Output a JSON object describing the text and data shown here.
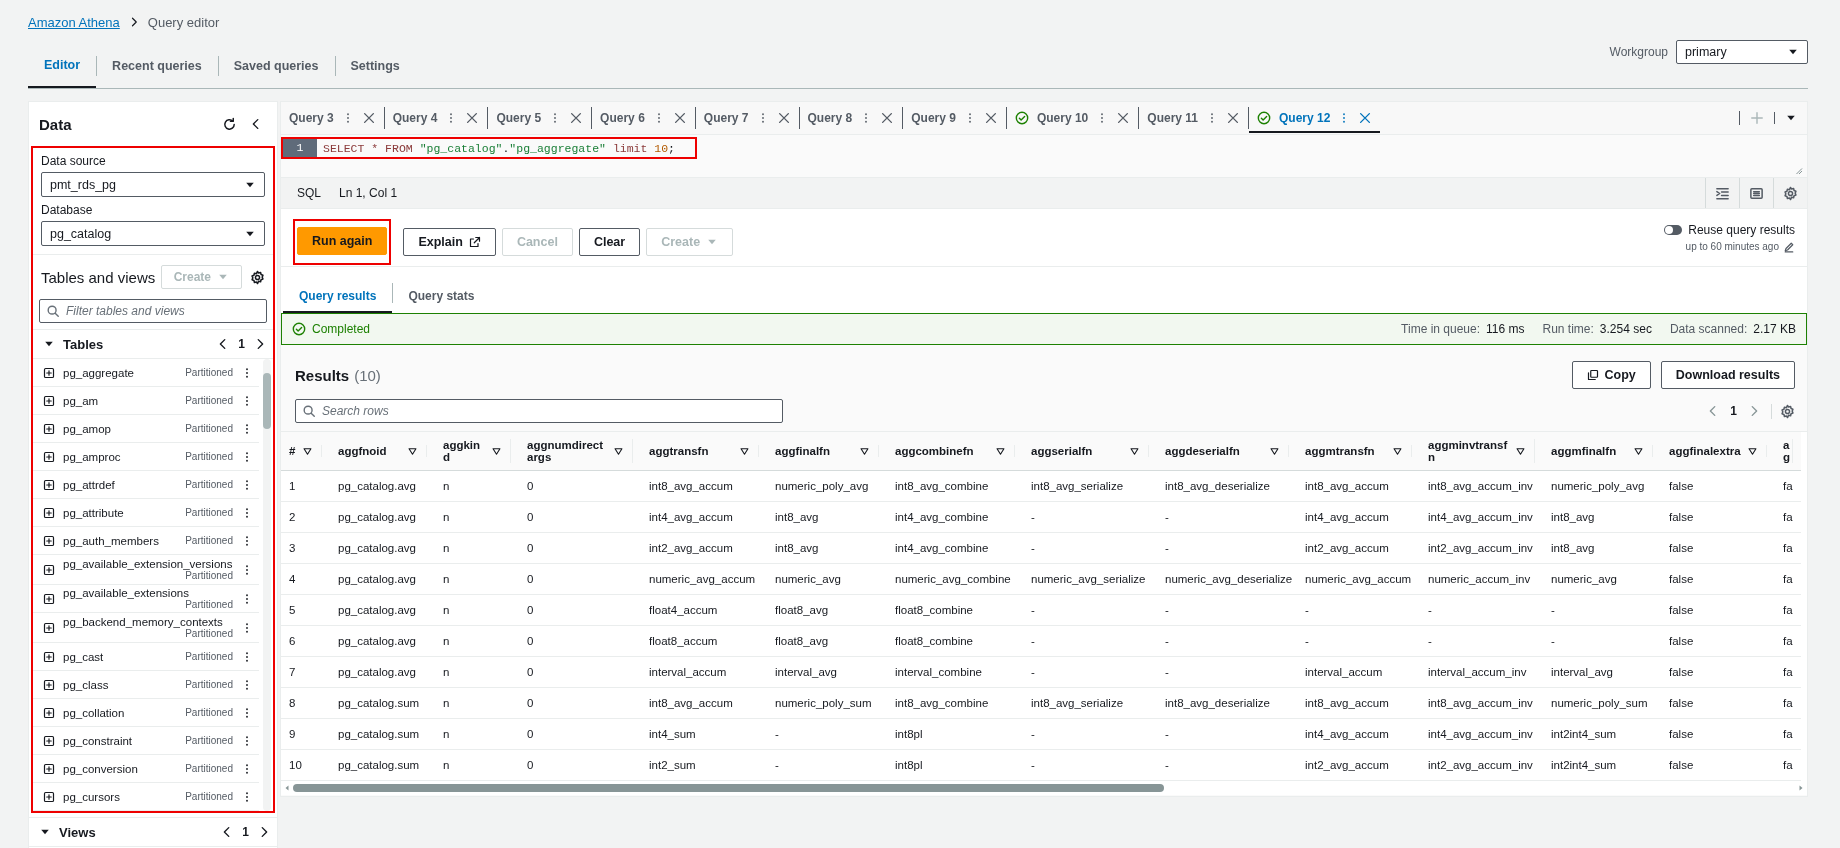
{
  "breadcrumb": [
    {
      "label": "Amazon Athena",
      "kind": "link"
    },
    {
      "label": "Query editor",
      "kind": "current"
    }
  ],
  "top_tabs": [
    {
      "label": "Editor",
      "selected": true
    },
    {
      "label": "Recent queries",
      "selected": false
    },
    {
      "label": "Saved queries",
      "selected": false
    },
    {
      "label": "Settings",
      "selected": false
    }
  ],
  "workgroup": {
    "label": "Workgroup",
    "value": "primary"
  },
  "sidebar": {
    "title": "Data",
    "data_source": {
      "label": "Data source",
      "value": "pmt_rds_pg"
    },
    "database": {
      "label": "Database",
      "value": "pg_catalog"
    },
    "tables_and_views": {
      "title": "Tables and views",
      "create": "Create"
    },
    "filter": {
      "placeholder": "Filter tables and views"
    },
    "tables": {
      "title": "Tables",
      "page": "1",
      "items": [
        {
          "name": "pg_aggregate",
          "badge": "Partitioned"
        },
        {
          "name": "pg_am",
          "badge": "Partitioned"
        },
        {
          "name": "pg_amop",
          "badge": "Partitioned"
        },
        {
          "name": "pg_amproc",
          "badge": "Partitioned"
        },
        {
          "name": "pg_attrdef",
          "badge": "Partitioned"
        },
        {
          "name": "pg_attribute",
          "badge": "Partitioned"
        },
        {
          "name": "pg_auth_members",
          "badge": "Partitioned"
        },
        {
          "name": "pg_available_extension_versions",
          "badge": "Partitioned"
        },
        {
          "name": "pg_available_extensions",
          "badge": "Partitioned"
        },
        {
          "name": "pg_backend_memory_contexts",
          "badge": "Partitioned"
        },
        {
          "name": "pg_cast",
          "badge": "Partitioned"
        },
        {
          "name": "pg_class",
          "badge": "Partitioned"
        },
        {
          "name": "pg_collation",
          "badge": "Partitioned"
        },
        {
          "name": "pg_constraint",
          "badge": "Partitioned"
        },
        {
          "name": "pg_conversion",
          "badge": "Partitioned"
        },
        {
          "name": "pg_cursors",
          "badge": "Partitioned"
        }
      ]
    },
    "views": {
      "title": "Views",
      "page": "1"
    }
  },
  "query_tabs": [
    {
      "label": "Query 3",
      "selected": false,
      "completed": false
    },
    {
      "label": "Query 4",
      "selected": false,
      "completed": false
    },
    {
      "label": "Query 5",
      "selected": false,
      "completed": false
    },
    {
      "label": "Query 6",
      "selected": false,
      "completed": false
    },
    {
      "label": "Query 7",
      "selected": false,
      "completed": false
    },
    {
      "label": "Query 8",
      "selected": false,
      "completed": false
    },
    {
      "label": "Query 9",
      "selected": false,
      "completed": false
    },
    {
      "label": "Query 10",
      "selected": false,
      "completed": true
    },
    {
      "label": "Query 11",
      "selected": false,
      "completed": false
    },
    {
      "label": "Query 12",
      "selected": true,
      "completed": true
    }
  ],
  "editor": {
    "lines": [
      {
        "number": "1",
        "tokens": [
          {
            "text": "SELECT * FROM ",
            "kind": "keyword"
          },
          {
            "text": "\"pg_catalog\"",
            "kind": "string"
          },
          {
            "text": ".",
            "kind": "plain"
          },
          {
            "text": "\"pg_aggregate\"",
            "kind": "string"
          },
          {
            "text": " limit ",
            "kind": "keyword"
          },
          {
            "text": "10",
            "kind": "number"
          },
          {
            "text": ";",
            "kind": "plain"
          }
        ]
      }
    ]
  },
  "editor_status": {
    "language": "SQL",
    "position": "Ln 1, Col 1"
  },
  "actions": [
    {
      "label": "Run again",
      "kind": "primary",
      "disabled": false
    },
    {
      "label": "Explain",
      "kind": "external",
      "disabled": false
    },
    {
      "label": "Cancel",
      "kind": "plain",
      "disabled": true
    },
    {
      "label": "Clear",
      "kind": "plain",
      "disabled": false
    },
    {
      "label": "Create",
      "kind": "dropdown",
      "disabled": true
    }
  ],
  "reuse": {
    "label": "Reuse query results",
    "on": false,
    "note": "up to 60 minutes ago"
  },
  "result_tabs": [
    {
      "label": "Query results",
      "selected": true
    },
    {
      "label": "Query stats",
      "selected": false
    }
  ],
  "status": {
    "text": "Completed",
    "stats": [
      {
        "label": "Time in queue:",
        "value": "116 ms"
      },
      {
        "label": "Run time:",
        "value": "3.254 sec"
      },
      {
        "label": "Data scanned:",
        "value": "2.17 KB"
      }
    ]
  },
  "results": {
    "title": "Results",
    "count": "(10)",
    "copy": "Copy",
    "download": "Download results",
    "search": {
      "placeholder": "Search rows"
    },
    "page": "1",
    "columns": [
      "#",
      "aggfnoid",
      "aggkind",
      "aggnumdirectargs",
      "aggtransfn",
      "aggfinalfn",
      "aggcombinefn",
      "aggserialfn",
      "aggdeserialfn",
      "aggmtransfn",
      "aggminvtransfn",
      "aggmfinalfn",
      "aggfinalextra",
      "ag"
    ],
    "rows": [
      [
        "1",
        "pg_catalog.avg",
        "n",
        "0",
        "int8_avg_accum",
        "numeric_poly_avg",
        "int8_avg_combine",
        "int8_avg_serialize",
        "int8_avg_deserialize",
        "int8_avg_accum",
        "int8_avg_accum_inv",
        "numeric_poly_avg",
        "false",
        "fa"
      ],
      [
        "2",
        "pg_catalog.avg",
        "n",
        "0",
        "int4_avg_accum",
        "int8_avg",
        "int4_avg_combine",
        "-",
        "-",
        "int4_avg_accum",
        "int4_avg_accum_inv",
        "int8_avg",
        "false",
        "fa"
      ],
      [
        "3",
        "pg_catalog.avg",
        "n",
        "0",
        "int2_avg_accum",
        "int8_avg",
        "int4_avg_combine",
        "-",
        "-",
        "int2_avg_accum",
        "int2_avg_accum_inv",
        "int8_avg",
        "false",
        "fa"
      ],
      [
        "4",
        "pg_catalog.avg",
        "n",
        "0",
        "numeric_avg_accum",
        "numeric_avg",
        "numeric_avg_combine",
        "numeric_avg_serialize",
        "numeric_avg_deserialize",
        "numeric_avg_accum",
        "numeric_accum_inv",
        "numeric_avg",
        "false",
        "fa"
      ],
      [
        "5",
        "pg_catalog.avg",
        "n",
        "0",
        "float4_accum",
        "float8_avg",
        "float8_combine",
        "-",
        "-",
        "-",
        "-",
        "-",
        "false",
        "fa"
      ],
      [
        "6",
        "pg_catalog.avg",
        "n",
        "0",
        "float8_accum",
        "float8_avg",
        "float8_combine",
        "-",
        "-",
        "-",
        "-",
        "-",
        "false",
        "fa"
      ],
      [
        "7",
        "pg_catalog.avg",
        "n",
        "0",
        "interval_accum",
        "interval_avg",
        "interval_combine",
        "-",
        "-",
        "interval_accum",
        "interval_accum_inv",
        "interval_avg",
        "false",
        "fa"
      ],
      [
        "8",
        "pg_catalog.sum",
        "n",
        "0",
        "int8_avg_accum",
        "numeric_poly_sum",
        "int8_avg_combine",
        "int8_avg_serialize",
        "int8_avg_deserialize",
        "int8_avg_accum",
        "int8_avg_accum_inv",
        "numeric_poly_sum",
        "false",
        "fa"
      ],
      [
        "9",
        "pg_catalog.sum",
        "n",
        "0",
        "int4_sum",
        "-",
        "int8pl",
        "-",
        "-",
        "int4_avg_accum",
        "int4_avg_accum_inv",
        "int2int4_sum",
        "false",
        "fa"
      ],
      [
        "10",
        "pg_catalog.sum",
        "n",
        "0",
        "int2_sum",
        "-",
        "int8pl",
        "-",
        "-",
        "int2_avg_accum",
        "int2_avg_accum_inv",
        "int2int4_sum",
        "false",
        "fa"
      ]
    ]
  }
}
